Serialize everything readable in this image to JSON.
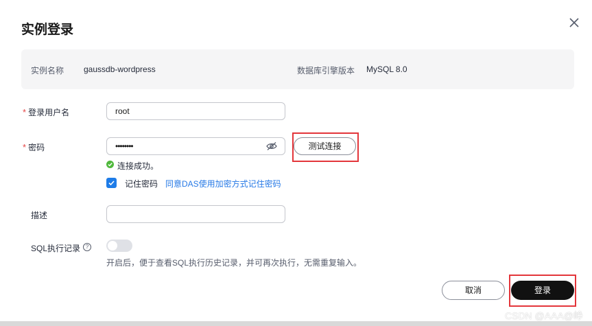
{
  "dialog": {
    "title": "实例登录"
  },
  "instance_info": {
    "name_label": "实例名称",
    "name_value": "gaussdb-wordpress",
    "engine_label": "数据库引擎版本",
    "engine_value": "MySQL 8.0"
  },
  "form": {
    "username": {
      "label": "登录用户名",
      "value": "root",
      "required": true
    },
    "password": {
      "label": "密码",
      "value": "••••••••",
      "required": true
    },
    "test_button": "测试连接",
    "connection_status": "连接成功。",
    "remember_password": {
      "label": "记住密码",
      "checked": true
    },
    "agreement_link": "同意DAS使用加密方式记住密码",
    "description": {
      "label": "描述",
      "value": ""
    },
    "sql_record": {
      "label": "SQL执行记录",
      "enabled": false,
      "hint": "开启后，便于查看SQL执行历史记录，并可再次执行，无需重复输入。"
    }
  },
  "footer": {
    "cancel_label": "取消",
    "login_label": "登录"
  },
  "watermark": "CSDN @AAA@峥",
  "colors": {
    "primary_button": "#111111",
    "link": "#2679e6",
    "required": "#e54545",
    "success": "#50b83c",
    "checkbox": "#1e7ce8",
    "highlight_box": "#e3353a"
  }
}
